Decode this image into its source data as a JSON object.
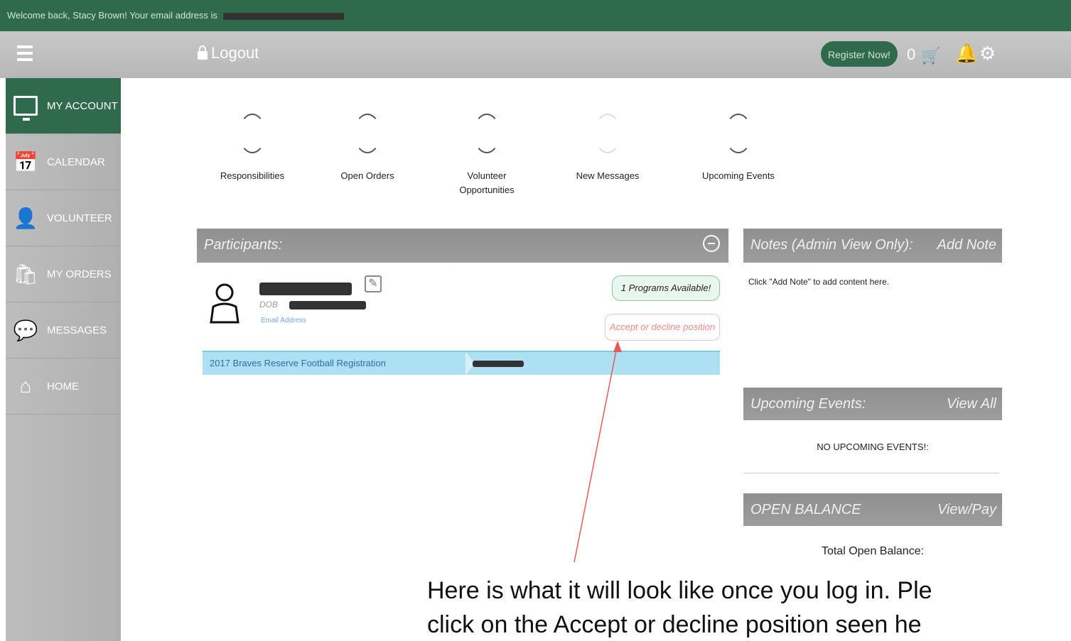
{
  "welcome_bar": {
    "text": "Welcome back, Stacy Brown! Your email address is"
  },
  "topbar": {
    "logout_label": "Logout",
    "register_label": "Register Now!",
    "cart_count": "0"
  },
  "sidebar": {
    "items": [
      {
        "label": "MY ACCOUNT",
        "icon": "monitor-icon",
        "active": true
      },
      {
        "label": "CALENDAR",
        "icon": "calendar-icon",
        "active": false
      },
      {
        "label": "VOLUNTEER",
        "icon": "volunteer-icon",
        "active": false
      },
      {
        "label": "MY ORDERS",
        "icon": "orders-icon",
        "active": false
      },
      {
        "label": "MESSAGES",
        "icon": "messages-icon",
        "active": false
      },
      {
        "label": "HOME",
        "icon": "home-icon",
        "active": false
      }
    ]
  },
  "stats": [
    {
      "label": "Responsibilities"
    },
    {
      "label": "Open Orders"
    },
    {
      "label": "Volunteer Opportunities"
    },
    {
      "label": "New Messages"
    },
    {
      "label": "Upcoming Events"
    }
  ],
  "participants": {
    "title": "Participants:",
    "dob_prefix": "DOB",
    "email_label": "Email Address",
    "programs_badge": "1 Programs Available!",
    "accept_label": "Accept or decline position",
    "program_name": "2017 Braves Reserve Football Registration"
  },
  "notes": {
    "title": "Notes (Admin View Only):",
    "action": "Add Note",
    "body": "Click \"Add Note\" to add content here."
  },
  "upcoming_events": {
    "title": "Upcoming Events:",
    "action": "View All",
    "empty": "NO UPCOMING EVENTS!:"
  },
  "open_balance": {
    "title": "OPEN BALANCE",
    "action": "View/Pay",
    "total_label": "Total Open Balance:"
  },
  "caption": {
    "line1": "Here is what it will look like once you log in. Ple",
    "line2": "click on the Accept or decline position seen he"
  },
  "colors": {
    "brand_green": "#2f6a4c",
    "header_gray": "#b7b7b7",
    "program_row": "#aee0f3",
    "accept_text": "#f08b8b"
  }
}
